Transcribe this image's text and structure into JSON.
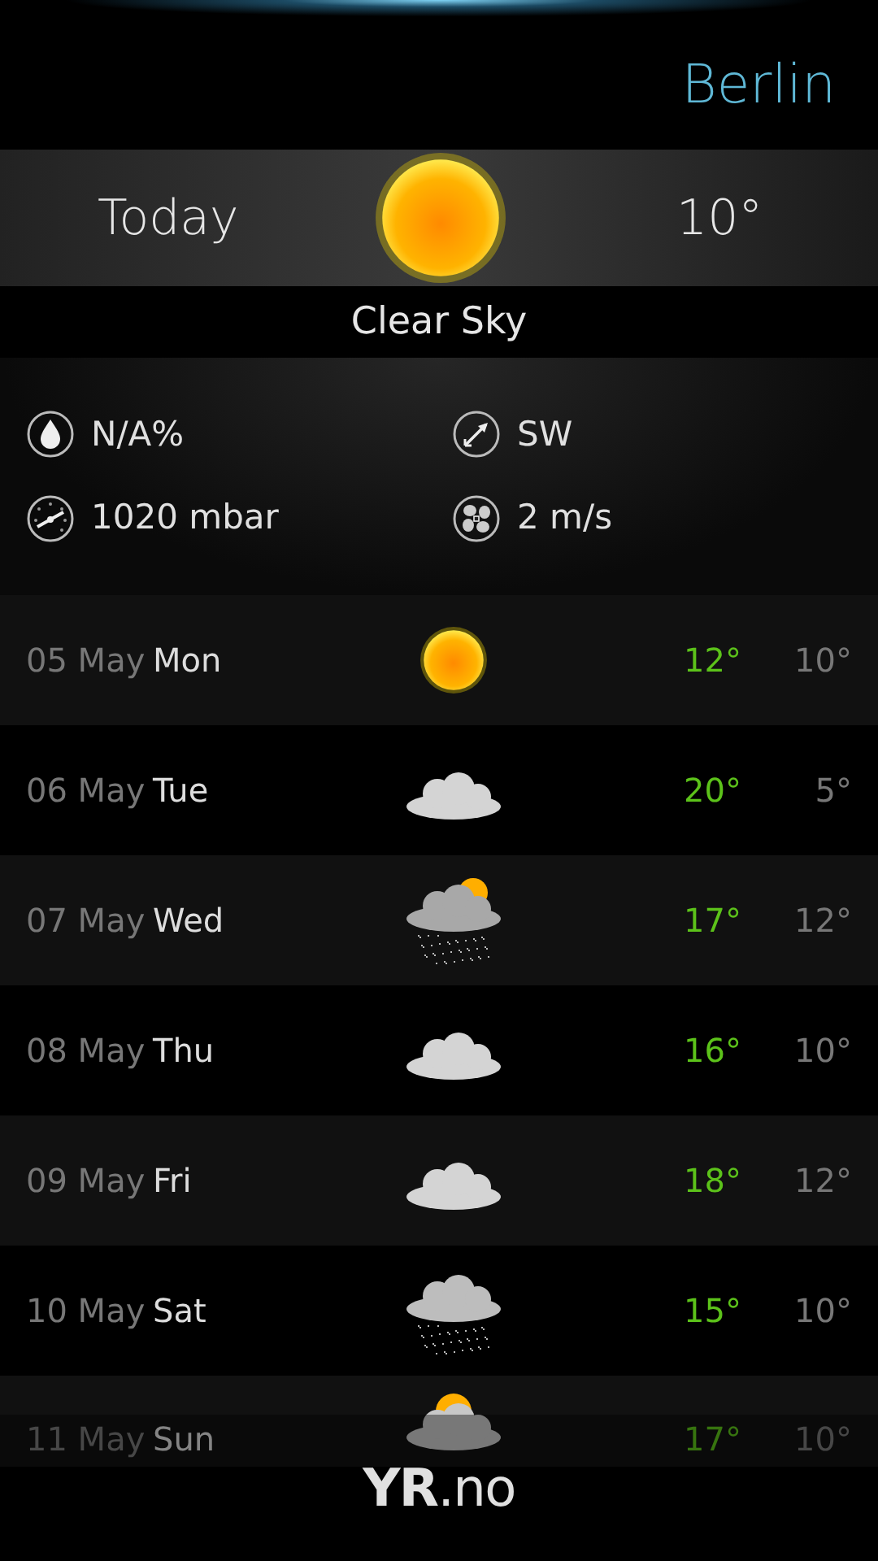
{
  "location": {
    "name": "Berlin"
  },
  "today": {
    "label": "Today",
    "kind": "sun",
    "temperature": "10°",
    "condition": "Clear Sky"
  },
  "details": [
    {
      "kind": "humidity",
      "value": "N/A%"
    },
    {
      "kind": "wind_direction",
      "value": "SW"
    },
    {
      "kind": "pressure",
      "value": "1020 mbar"
    },
    {
      "kind": "wind_speed",
      "value": "2 m/s"
    }
  ],
  "forecast": [
    {
      "date": "05 May",
      "day": "Mon",
      "kind": "sun",
      "high": "12°",
      "low": "10°"
    },
    {
      "date": "06 May",
      "day": "Tue",
      "kind": "cloud",
      "high": "20°",
      "low": "5°"
    },
    {
      "date": "07 May",
      "day": "Wed",
      "kind": "rain_sun",
      "high": "17°",
      "low": "12°"
    },
    {
      "date": "08 May",
      "day": "Thu",
      "kind": "cloud",
      "high": "16°",
      "low": "10°"
    },
    {
      "date": "09 May",
      "day": "Fri",
      "kind": "cloud",
      "high": "18°",
      "low": "12°"
    },
    {
      "date": "10 May",
      "day": "Sat",
      "kind": "rain",
      "high": "15°",
      "low": "10°"
    },
    {
      "date": "11 May",
      "day": "Sun",
      "kind": "cloud_sun",
      "high": "17°",
      "low": "10°"
    }
  ],
  "footer": {
    "logo": "**YR**.no"
  }
}
